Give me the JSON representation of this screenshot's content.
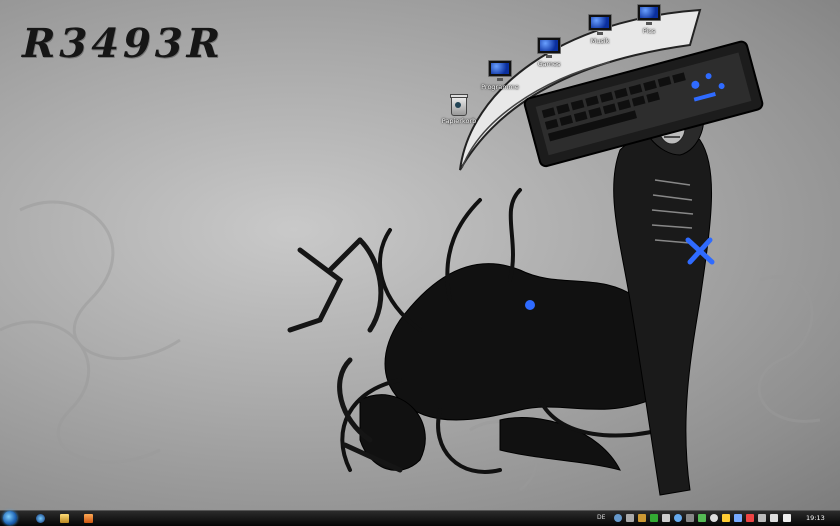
{
  "desktop": {
    "logo_text": "R3493R",
    "icons": [
      {
        "label": "Papierkorb",
        "type": "recycle-bin"
      },
      {
        "label": "Programme",
        "type": "monitor"
      },
      {
        "label": "Games",
        "type": "monitor"
      },
      {
        "label": "Musik",
        "type": "monitor"
      },
      {
        "label": "Pics",
        "type": "monitor"
      }
    ]
  },
  "taskbar": {
    "pinned": [
      "internet-explorer-icon",
      "windows-explorer-icon",
      "media-player-icon"
    ],
    "language": "DE",
    "clock": "19:13"
  },
  "colors": {
    "taskbar": "#0a0a0a",
    "accent_blue": "#2f6bff"
  }
}
